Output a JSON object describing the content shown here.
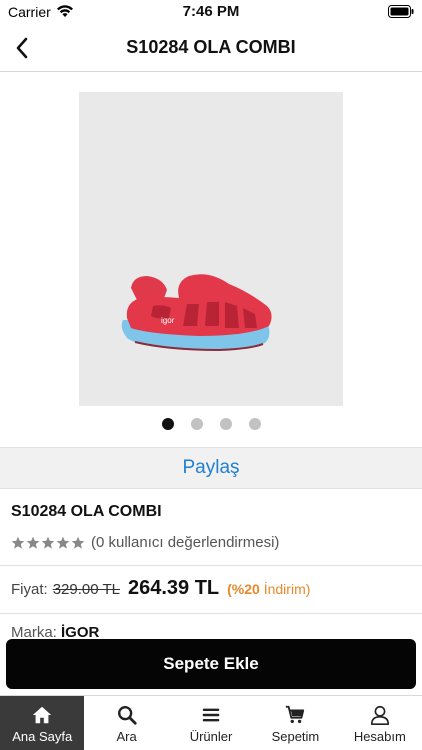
{
  "status_bar": {
    "carrier": "Carrier",
    "time": "7:46 PM"
  },
  "header": {
    "title": "S10284 OLA COMBI",
    "back_icon": "chevron-left-icon"
  },
  "product_image": {
    "description_icon": "sandal-image",
    "background_color": "#e9e9e9",
    "dots_total": 4,
    "dots_active_index": 0
  },
  "share": {
    "label": "Paylaş",
    "color": "#1f7fd1"
  },
  "product": {
    "name": "S10284 OLA COMBI",
    "rating": 5,
    "rating_text": "(0 kullanıcı değerlendirmesi)",
    "price_label": "Fiyat:",
    "old_price": "329.00 TL",
    "new_price": "264.39 TL",
    "discount_percent": "(%20",
    "discount_word": "İndirim)",
    "discount_color": "#e8882b",
    "brand_label": "Marka:",
    "brand_value": "İGOR"
  },
  "cta": {
    "add_to_cart": "Sepete Ekle"
  },
  "tab_bar": {
    "active_color": "#3a3a3a",
    "items": [
      {
        "label": "Ana Sayfa",
        "icon": "home-icon"
      },
      {
        "label": "Ara",
        "icon": "search-icon"
      },
      {
        "label": "Ürünler",
        "icon": "menu-icon"
      },
      {
        "label": "Sepetim",
        "icon": "cart-icon"
      },
      {
        "label": "Hesabım",
        "icon": "user-icon"
      }
    ]
  }
}
